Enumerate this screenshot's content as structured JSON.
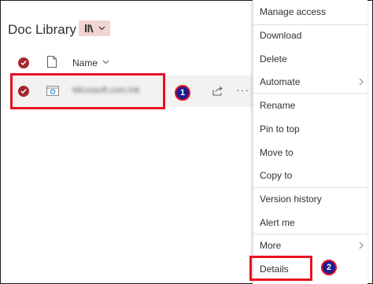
{
  "library": {
    "title": "Doc Library",
    "view_icon": "library-icon"
  },
  "list": {
    "column_name": "Name",
    "row": {
      "file_name": "Microsoft.com.lnk",
      "selected": true
    }
  },
  "context_menu": {
    "items": [
      {
        "label": "Manage access"
      },
      {
        "label": "Download"
      },
      {
        "label": "Delete"
      },
      {
        "label": "Automate",
        "submenu": true
      },
      {
        "label": "Rename"
      },
      {
        "label": "Pin to top"
      },
      {
        "label": "Move to"
      },
      {
        "label": "Copy to"
      },
      {
        "label": "Version history"
      },
      {
        "label": "Alert me"
      },
      {
        "label": "More",
        "submenu": true
      },
      {
        "label": "Details"
      }
    ]
  },
  "annotations": {
    "badge_1": "1",
    "badge_2": "2"
  },
  "colors": {
    "accent": "#a4262c",
    "highlight": "#e81123",
    "badge_fill": "#1a1c8e"
  }
}
